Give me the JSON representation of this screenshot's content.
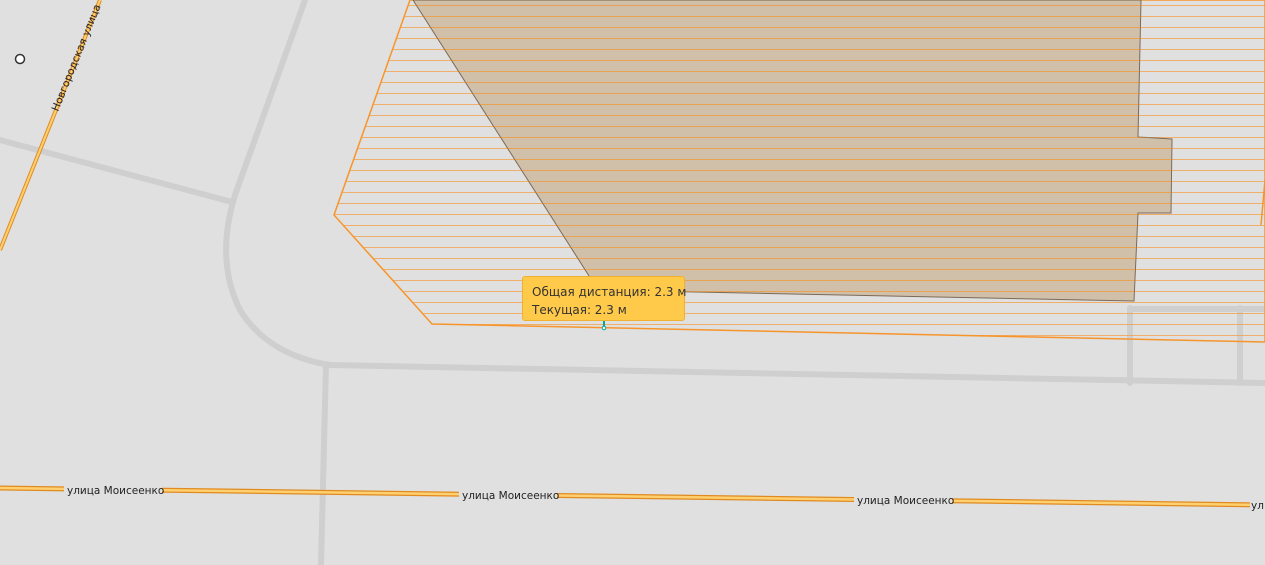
{
  "map": {
    "streets": [
      {
        "name": "Новгородская улица"
      },
      {
        "name": "улица Моисеенко"
      }
    ],
    "street_labels": [
      "Новгородская улица",
      "улица Моисеенко",
      "улица Моисеенко",
      "улица Моисеенко",
      "ул"
    ],
    "colors": {
      "background": "#e0e0e0",
      "minor_road": "#cccccc",
      "street_casing": "#e08a20",
      "street_fill": "#ffd070",
      "selection_outline": "#f7952b",
      "building_fill": "#d3bfa6",
      "tooltip_background": "#ffc94a",
      "measure_line": "#00a896"
    }
  },
  "measurement": {
    "total_label": "Общая дистанция: 2.3 м",
    "current_label": "Текущая: 2.3 м"
  }
}
